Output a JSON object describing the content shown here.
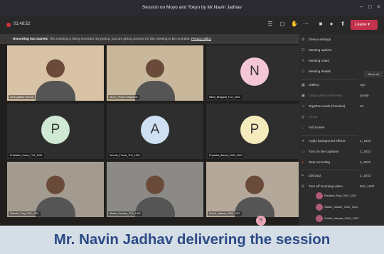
{
  "window": {
    "title": "Session on Moyo and Tokyo by Mr.Navin Jadhav"
  },
  "toolbar": {
    "timer": "01:48:52",
    "leave_label": "Leave"
  },
  "banner": {
    "bold": "Recording has started.",
    "text": " This meeting is being recorded. By joining, you are giving consent for this meeting to be recorded. ",
    "link": "Privacy policy"
  },
  "participants": [
    {
      "name": "navin jadhav (Guest)",
      "type": "video",
      "bg": "#d9c3a6"
    },
    {
      "name": "MCA7_Priya Deshpande",
      "type": "video",
      "bg": "#c8b79a"
    },
    {
      "name": "Nikhil_Bhagwat_TC2_1922",
      "type": "avatar",
      "initial": "N",
      "color": "#f4c6d6"
    },
    {
      "name": "Prathisha_Sarne_TC2_1922",
      "type": "avatar",
      "initial": "P",
      "color": "#cfe9d5"
    },
    {
      "name": "Amruta_Thorat_TC2_1922",
      "type": "avatar",
      "initial": "A",
      "color": "#cfe0f2"
    },
    {
      "name": "Priyanka_Bamat_CW2_1922",
      "type": "avatar",
      "initial": "P",
      "color": "#f6ebbd"
    },
    {
      "name": "Rishabh_Raj_CW2_1922",
      "type": "video",
      "bg": "#a49b90"
    },
    {
      "name": "Akash_Gurnkar_TC2_1922",
      "type": "video",
      "bg": "#8c8a87"
    },
    {
      "name": "Sushil_Jaiswal_CW2_1922",
      "type": "video",
      "bg": "#b4a89a"
    }
  ],
  "menu": {
    "items": [
      {
        "icon": "gear",
        "label": "Device settings",
        "value": ""
      },
      {
        "icon": "options",
        "label": "Meeting options",
        "value": ""
      },
      {
        "icon": "notes",
        "label": "Meeting notes",
        "value": ""
      },
      {
        "icon": "info",
        "label": "Meeting details",
        "value": ""
      },
      {
        "icon": "gallery",
        "label": "Gallery",
        "value": "nge"
      },
      {
        "icon": "large",
        "label": "Large gallery (Preview)",
        "value": "yande"
      },
      {
        "icon": "together",
        "label": "Together mode (Preview)",
        "value": "ə0"
      },
      {
        "icon": "focus",
        "label": "Focus",
        "value": ""
      },
      {
        "icon": "fullscreen",
        "label": "Full screen",
        "value": ""
      },
      {
        "icon": "background",
        "label": "Apply background effects",
        "value": "2_1922"
      },
      {
        "icon": "captions",
        "label": "Turn on live captions",
        "value": "2_1922"
      },
      {
        "icon": "record",
        "label": "Stop recording",
        "value": "2_1922"
      },
      {
        "icon": "dialpad",
        "label": "Dial pad",
        "value": "2_1922"
      },
      {
        "icon": "video-off",
        "label": "Turn off incoming video",
        "value": "962_1922"
      }
    ],
    "show_all": "Show all"
  },
  "side_list": [
    {
      "name": "Rishabh_Raj_CW2_1922"
    },
    {
      "name": "Satish_Gadhe_CW2_1922"
    },
    {
      "name": "Sushil_Jaiswal_CW2_1922"
    }
  ],
  "floating_avatar": "S",
  "caption": "Mr. Navin Jadhav delivering the  session"
}
